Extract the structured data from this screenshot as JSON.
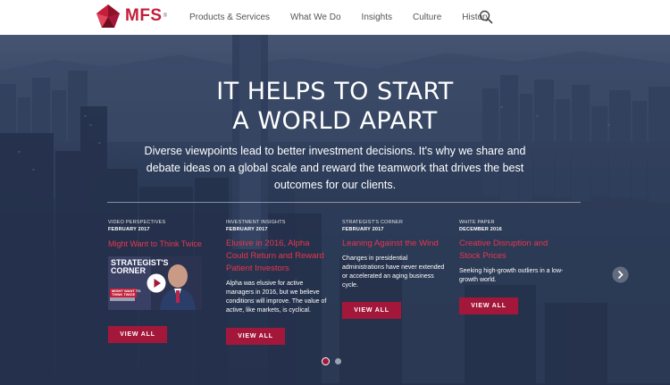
{
  "header": {
    "logo_text": "MFS",
    "logo_reg": "®",
    "nav": [
      "Products & Services",
      "What We Do",
      "Insights",
      "Culture",
      "History"
    ]
  },
  "hero": {
    "headline_line1": "IT HELPS TO START",
    "headline_line2": "A WORLD APART",
    "subhead": "Diverse viewpoints lead to better investment decisions. It's why we share and debate ideas on a global scale and reward the teamwork that drives the best outcomes for our clients."
  },
  "video_thumb": {
    "line1": "STRATEGIST'S",
    "line2": "CORNER",
    "tag1": "MIGHT WANT TO",
    "tag2": "THINK TWICE"
  },
  "cards": [
    {
      "category": "VIDEO PERSPECTIVES",
      "date": "FEBRUARY 2017",
      "title": "Might Want to Think Twice",
      "body": "",
      "button": "VIEW ALL"
    },
    {
      "category": "INVESTMENT INSIGHTS",
      "date": "FEBRUARY 2017",
      "title": "Elusive in 2016, Alpha Could Return and Reward Patient Investors",
      "body": "Alpha was elusive for active managers in 2016, but we believe conditions will improve. The value of active, like markets, is cyclical.",
      "button": "VIEW ALL"
    },
    {
      "category": "STRATEGIST'S CORNER",
      "date": "FEBRUARY 2017",
      "title": "Leaning Against the Wind",
      "body": "Changes in presidential administrations have never extended or accelerated an aging business cycle.",
      "button": "VIEW ALL"
    },
    {
      "category": "WHITE PAPER",
      "date": "DECEMBER 2016",
      "title": "Creative Disruption and Stock Prices",
      "body": "Seeking high-growth outliers in a low-growth world.",
      "button": "VIEW ALL"
    }
  ],
  "colors": {
    "brand_red": "#c41e3a",
    "button_red": "#a3183a",
    "title_red": "#e8364f"
  },
  "icons": {
    "search": "search-icon",
    "next": "chevron-right-icon",
    "play": "play-icon"
  }
}
